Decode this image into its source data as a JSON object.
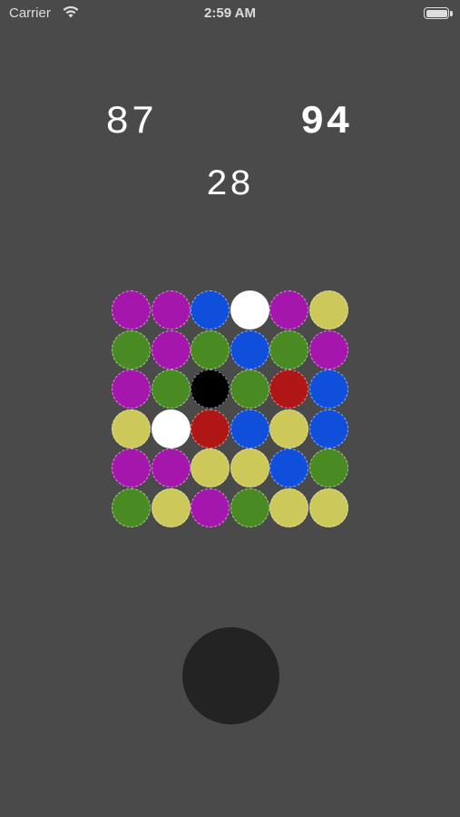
{
  "status_bar": {
    "carrier": "Carrier",
    "time": "2:59 AM",
    "wifi_icon": "wifi-icon",
    "battery_icon": "battery-icon",
    "battery_level": 1.0
  },
  "scores": {
    "left": "87",
    "right": "94",
    "center": "28"
  },
  "colors": {
    "background": "#4a4a4a",
    "purple": "#a516ac",
    "blue": "#0f4fdb",
    "white": "#ffffff",
    "yellow": "#cdc85a",
    "green": "#4a8a22",
    "black": "#000000",
    "red": "#b01616",
    "button": "#232323"
  },
  "board": {
    "rows": 6,
    "cols": 6,
    "cells": [
      [
        "purple",
        "purple",
        "blue",
        "white",
        "purple",
        "yellow"
      ],
      [
        "green",
        "purple",
        "green",
        "blue",
        "green",
        "purple"
      ],
      [
        "purple",
        "green",
        "black",
        "green",
        "red",
        "blue"
      ],
      [
        "yellow",
        "white",
        "red",
        "blue",
        "yellow",
        "blue"
      ],
      [
        "purple",
        "purple",
        "yellow",
        "yellow",
        "blue",
        "green"
      ],
      [
        "green",
        "yellow",
        "purple",
        "green",
        "yellow",
        "yellow"
      ]
    ]
  },
  "action_button": {
    "icon": "circle-button-icon"
  }
}
